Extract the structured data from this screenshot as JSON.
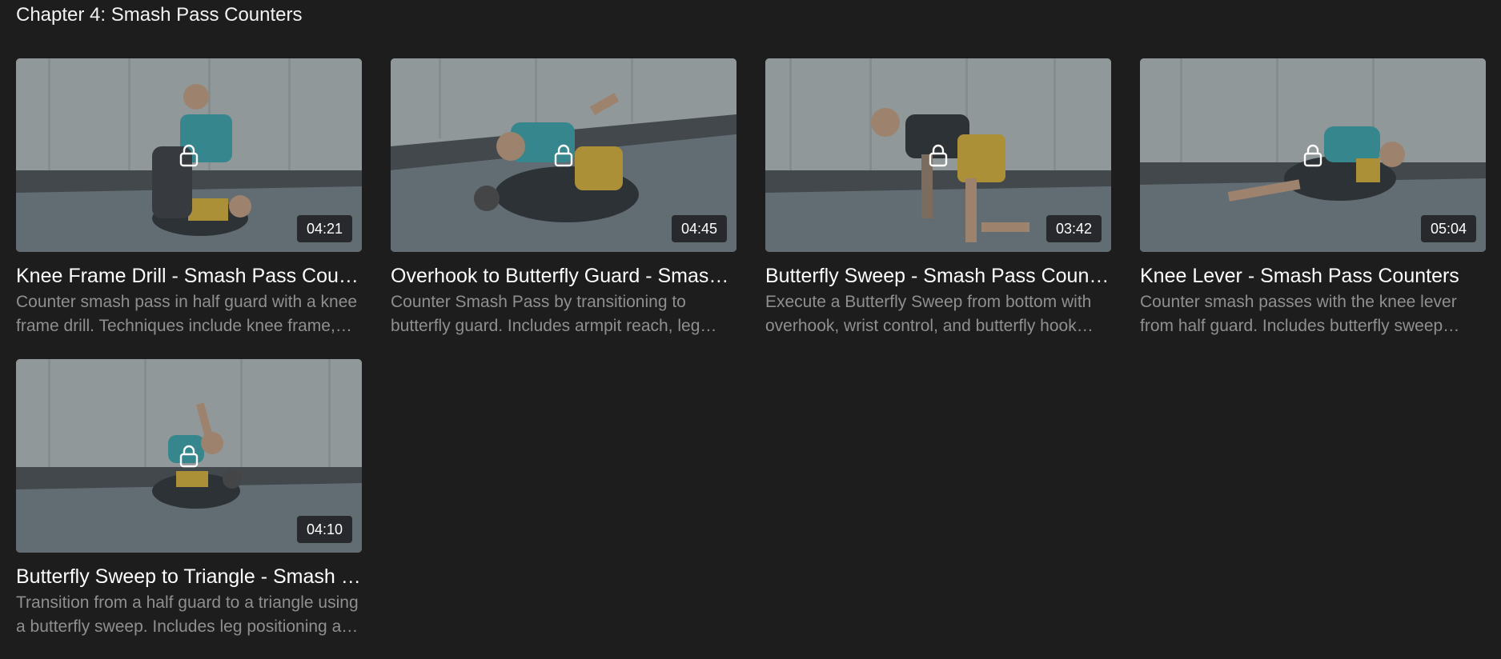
{
  "chapter": {
    "title": "Chapter 4: Smash Pass Counters"
  },
  "videos": [
    {
      "title": "Knee Frame Drill - Smash Pass Counters",
      "description": "Counter smash pass in half guard with a knee frame drill. Techniques include knee frame, underhook and recovery.",
      "duration": "04:21",
      "locked": true,
      "icon": "lock-icon"
    },
    {
      "title": "Overhook to Butterfly Guard - Smash Pass Counters",
      "description": "Counter Smash Pass by transitioning to butterfly guard. Includes armpit reach, leg pummel and hook insertion.",
      "duration": "04:45",
      "locked": true,
      "icon": "lock-icon"
    },
    {
      "title": "Butterfly Sweep - Smash Pass Counters",
      "description": "Execute a Butterfly Sweep from bottom with overhook, wrist control, and butterfly hook elevation.",
      "duration": "03:42",
      "locked": true,
      "icon": "lock-icon"
    },
    {
      "title": "Knee Lever - Smash Pass Counters",
      "description": "Counter smash passes with the knee lever from half guard. Includes butterfly sweep setups and finishes.",
      "duration": "05:04",
      "locked": true,
      "icon": "lock-icon"
    },
    {
      "title": "Butterfly Sweep to Triangle - Smash Pass Counters",
      "description": "Transition from a half guard to a triangle using a butterfly sweep. Includes leg positioning and finishing details.",
      "duration": "04:10",
      "locked": true,
      "icon": "lock-icon"
    }
  ],
  "colors": {
    "background": "#1d1d1d",
    "title_text": "#ffffff",
    "description_text": "#8f8f8f",
    "mat": "#6f7b82",
    "wall": "#a9b0b0",
    "rashguard_teal": "#3a9aa3",
    "shorts_yellow": "#c9a63a"
  }
}
